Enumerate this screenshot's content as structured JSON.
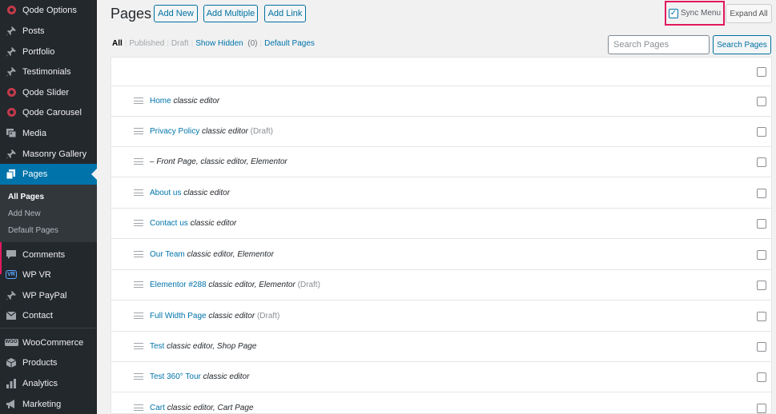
{
  "sidebar": {
    "items": [
      {
        "label": "Qode Options",
        "icon": "qode-icon"
      },
      {
        "label": "Posts",
        "icon": "pin-icon"
      },
      {
        "label": "Portfolio",
        "icon": "pin-icon"
      },
      {
        "label": "Testimonials",
        "icon": "pin-icon"
      },
      {
        "label": "Qode Slider",
        "icon": "qode-icon"
      },
      {
        "label": "Qode Carousel",
        "icon": "qode-icon"
      },
      {
        "label": "Media",
        "icon": "media-icon"
      },
      {
        "label": "Masonry Gallery",
        "icon": "pin-icon"
      },
      {
        "label": "Pages",
        "icon": "pages-icon"
      },
      {
        "label": "Comments",
        "icon": "comment-icon"
      },
      {
        "label": "WP VR",
        "icon": "vr-icon"
      },
      {
        "label": "WP PayPal",
        "icon": "pin-icon"
      },
      {
        "label": "Contact",
        "icon": "mail-icon"
      },
      {
        "label": "WooCommerce",
        "icon": "woo-icon"
      },
      {
        "label": "Products",
        "icon": "box-icon"
      },
      {
        "label": "Analytics",
        "icon": "bar-chart-icon"
      },
      {
        "label": "Marketing",
        "icon": "megaphone-icon"
      }
    ],
    "submenu": [
      "All Pages",
      "Add New",
      "Default Pages"
    ]
  },
  "header": {
    "title": "Pages",
    "add_new": "Add New",
    "add_multiple": "Add Multiple",
    "add_link": "Add Link",
    "sync_menu": "Sync Menu",
    "sync_checked": true,
    "expand_all": "Expand All"
  },
  "filters": {
    "all": "All",
    "published": "Published",
    "draft": "Draft",
    "show_hidden": "Show Hidden",
    "hidden_count": "(0)",
    "default_pages": "Default Pages"
  },
  "search": {
    "placeholder": "Search Pages",
    "button": "Search Pages"
  },
  "pages": [
    {
      "title": "Home",
      "meta": "classic editor",
      "state": ""
    },
    {
      "title": "Privacy Policy",
      "meta": "classic editor",
      "state": "(Draft)"
    },
    {
      "title": "",
      "meta": "– Front Page, classic editor, Elementor",
      "state": ""
    },
    {
      "title": "About us",
      "meta": "classic editor",
      "state": ""
    },
    {
      "title": "Contact us",
      "meta": "classic editor",
      "state": ""
    },
    {
      "title": "Our Team",
      "meta": "classic editor, Elementor",
      "state": ""
    },
    {
      "title": "Elementor #288",
      "meta": "classic editor, Elementor",
      "state": "(Draft)"
    },
    {
      "title": "Full Width Page",
      "meta": "classic editor",
      "state": "(Draft)"
    },
    {
      "title": "Test",
      "meta": "classic editor, Shop Page",
      "state": ""
    },
    {
      "title": "Test 360° Tour",
      "meta": "classic editor",
      "state": ""
    },
    {
      "title": "Cart",
      "meta": "classic editor, Cart Page",
      "state": ""
    }
  ],
  "colors": {
    "sidebar_bg": "#23282d",
    "accent": "#0073aa",
    "highlight_border": "#e2185d"
  }
}
